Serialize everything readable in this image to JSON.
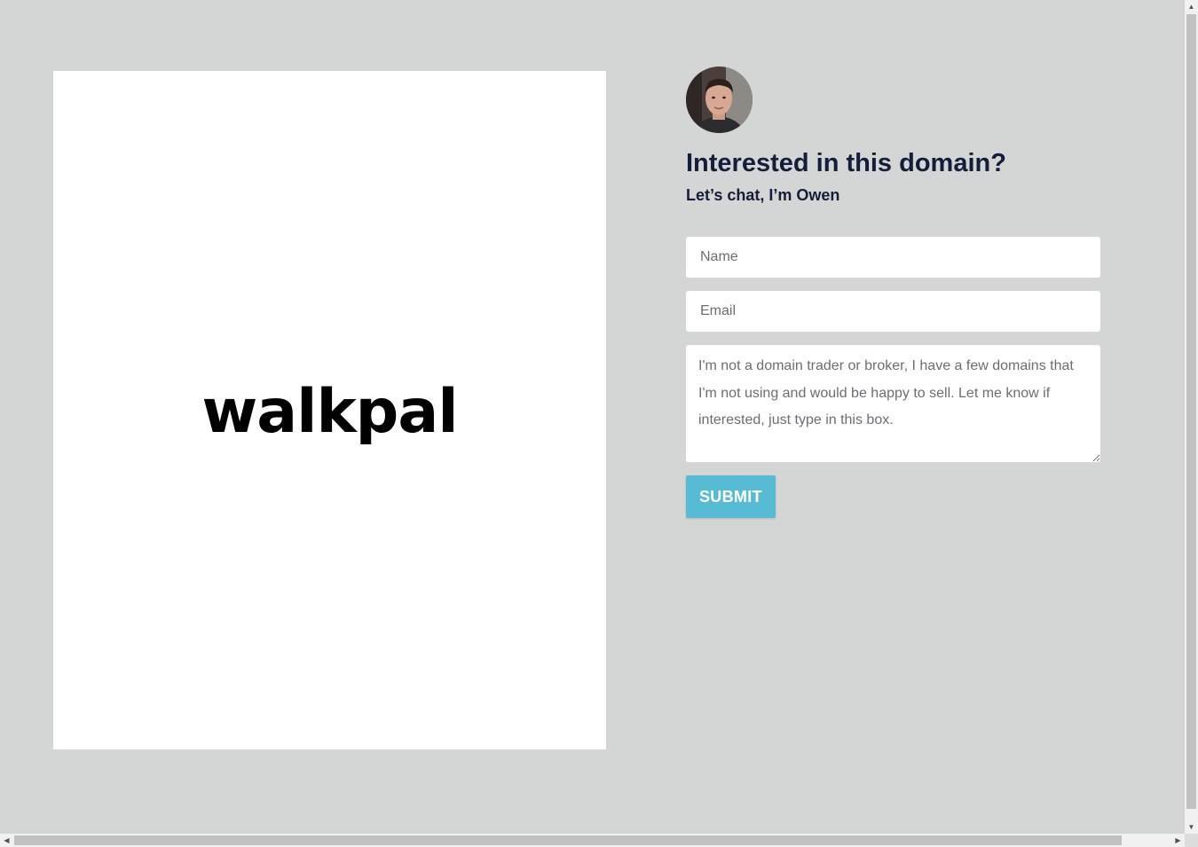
{
  "domain": {
    "name": "walkpal"
  },
  "contact": {
    "headline": "Interested in this domain?",
    "subline": "Let’s chat, I’m Owen",
    "avatar_icon": "avatar-photo"
  },
  "form": {
    "name_placeholder": "Name",
    "email_placeholder": "Email",
    "message_placeholder": "I'm not a domain trader or broker, I have a few domains that I'm not using and would be happy to sell. Let me know if interested, just type in this box.",
    "submit_label": "SUBMIT"
  },
  "colors": {
    "background": "#d3d6d4",
    "card": "#ffffff",
    "heading": "#141d3a",
    "button": "#57bcd3"
  }
}
